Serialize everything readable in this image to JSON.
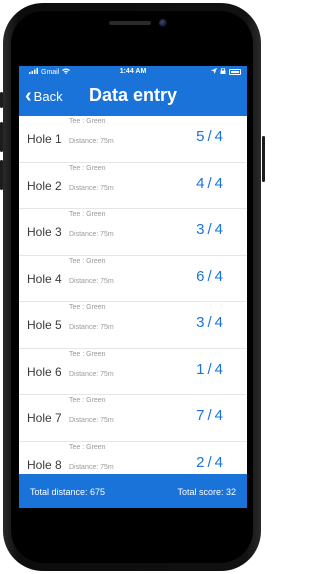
{
  "status_bar": {
    "carrier": "Gmail",
    "time": "1:44 AM"
  },
  "nav": {
    "back_label": "Back",
    "title": "Data entry"
  },
  "holes": [
    {
      "label": "Hole 1",
      "tee": "Tee : Green",
      "distance": "Distance: 75m",
      "score": "5",
      "par": "4"
    },
    {
      "label": "Hole 2",
      "tee": "Tee : Green",
      "distance": "Distance: 75m",
      "score": "4",
      "par": "4"
    },
    {
      "label": "Hole 3",
      "tee": "Tee : Green",
      "distance": "Distance: 75m",
      "score": "3",
      "par": "4"
    },
    {
      "label": "Hole 4",
      "tee": "Tee : Green",
      "distance": "Distance: 75m",
      "score": "6",
      "par": "4"
    },
    {
      "label": "Hole 5",
      "tee": "Tee : Green",
      "distance": "Distance: 75m",
      "score": "3",
      "par": "4"
    },
    {
      "label": "Hole 6",
      "tee": "Tee : Green",
      "distance": "Distance: 75m",
      "score": "1",
      "par": "4"
    },
    {
      "label": "Hole 7",
      "tee": "Tee : Green",
      "distance": "Distance: 75m",
      "score": "7",
      "par": "4"
    },
    {
      "label": "Hole 8",
      "tee": "Tee : Green",
      "distance": "Distance: 75m",
      "score": "2",
      "par": "4"
    }
  ],
  "footer": {
    "total_distance": "Total distance: 675",
    "total_score": "Total score: 32"
  },
  "colors": {
    "accent": "#1a73d8",
    "text": "#3a3a3a",
    "muted": "#9a9a9a"
  }
}
